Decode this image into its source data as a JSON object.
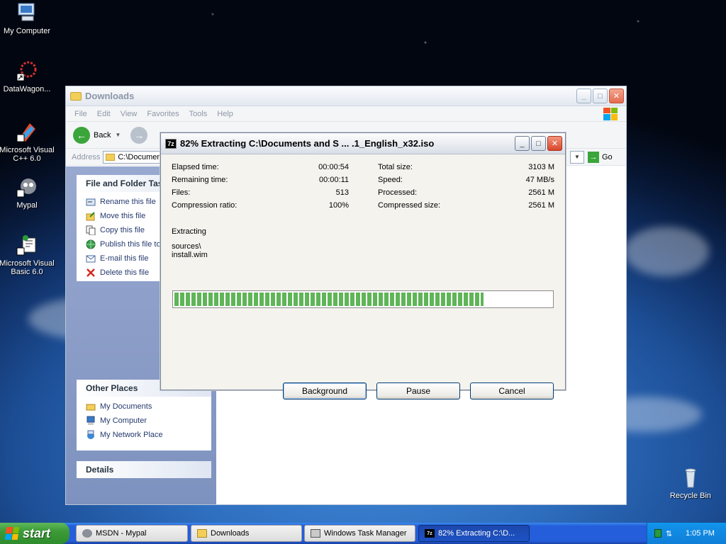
{
  "desktop": {
    "icons": [
      {
        "label": "My Computer"
      },
      {
        "label": "DataWagon..."
      },
      {
        "label": "Microsoft Visual C++ 6.0"
      },
      {
        "label": "Mypal"
      },
      {
        "label": "Microsoft Visual Basic 6.0"
      },
      {
        "label": "Recycle Bin"
      }
    ]
  },
  "explorer": {
    "title": "Downloads",
    "menu": [
      "File",
      "Edit",
      "View",
      "Favorites",
      "Tools",
      "Help"
    ],
    "toolbar": {
      "back": "Back"
    },
    "address_label": "Address",
    "address_value": "C:\\Documen",
    "go_label": "Go",
    "file_folder_tasks": {
      "title": "File and Folder Tas",
      "items": [
        "Rename this file",
        "Move this file",
        "Copy this file",
        "Publish this file to",
        "E-mail this file",
        "Delete this file"
      ]
    },
    "other_places": {
      "title": "Other Places",
      "items": [
        "My Documents",
        "My Computer",
        "My Network Place"
      ]
    },
    "details_title": "Details"
  },
  "dialog": {
    "title": "82% Extracting C:\\Documents and S ... .1_English_x32.iso",
    "left_stats": [
      {
        "label": "Elapsed time:",
        "value": "00:00:54"
      },
      {
        "label": "Remaining time:",
        "value": "00:00:11"
      },
      {
        "label": "Files:",
        "value": "513"
      },
      {
        "label": "Compression ratio:",
        "value": "100%"
      }
    ],
    "right_stats": [
      {
        "label": "Total size:",
        "value": "3103 M"
      },
      {
        "label": "Speed:",
        "value": "47 MB/s"
      },
      {
        "label": "Processed:",
        "value": "2561 M"
      },
      {
        "label": "Compressed size:",
        "value": "2561 M"
      }
    ],
    "status": "Extracting",
    "path_line1": "sources\\",
    "path_line2": "install.wim",
    "progress_fraction": 0.82,
    "buttons": {
      "background": "Background",
      "pause": "Pause",
      "cancel": "Cancel"
    }
  },
  "taskbar": {
    "start_label": "start",
    "items": [
      {
        "label": "MSDN - Mypal"
      },
      {
        "label": "Downloads"
      },
      {
        "label": "Windows Task Manager"
      },
      {
        "label": "82% Extracting C:\\D..."
      }
    ],
    "clock": "1:05 PM"
  }
}
